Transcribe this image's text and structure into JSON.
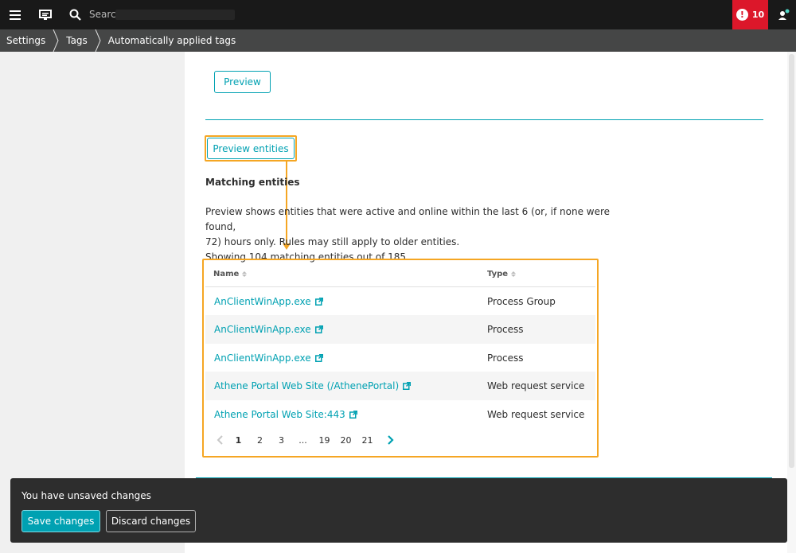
{
  "topbar": {
    "menu_icon": "hamburger-icon",
    "screen_icon": "monitor-icon",
    "search_icon": "search-icon",
    "search_placeholder": "Search",
    "alert_icon": "exclamation-icon",
    "alert_count": "10",
    "alert_color": "#dc172a",
    "user_icon": "user-icon"
  },
  "breadcrumb": [
    "Settings",
    "Tags",
    "Automatically applied tags"
  ],
  "main": {
    "preview_button": "Preview",
    "preview_entities_button": "Preview entities",
    "section_title": "Matching entities",
    "description_lines": [
      "Preview shows entities that were active and online within the last 6 (or, if none were found,",
      "72) hours only. Rules may still apply to older entities.",
      "Showing 104 matching entities out of 185."
    ],
    "table": {
      "columns": [
        "Name",
        "Type"
      ],
      "rows": [
        {
          "name": "AnClientWinApp.exe",
          "type": "Process Group"
        },
        {
          "name": "AnClientWinApp.exe",
          "type": "Process"
        },
        {
          "name": "AnClientWinApp.exe",
          "type": "Process"
        },
        {
          "name": "Athene Portal Web Site (/AthenePortal)",
          "type": "Web request service"
        },
        {
          "name": "Athene Portal Web Site:443",
          "type": "Web request service"
        }
      ]
    },
    "pagination": {
      "pages": [
        "1",
        "2",
        "3",
        "...",
        "19",
        "20",
        "21"
      ],
      "current": "1"
    }
  },
  "toast": {
    "message": "You have unsaved changes",
    "save_label": "Save changes",
    "discard_label": "Discard changes"
  },
  "colors": {
    "accent": "#00a1b2",
    "highlight": "#f5a623",
    "topbar": "#191919",
    "breadcrumb": "#454646"
  }
}
